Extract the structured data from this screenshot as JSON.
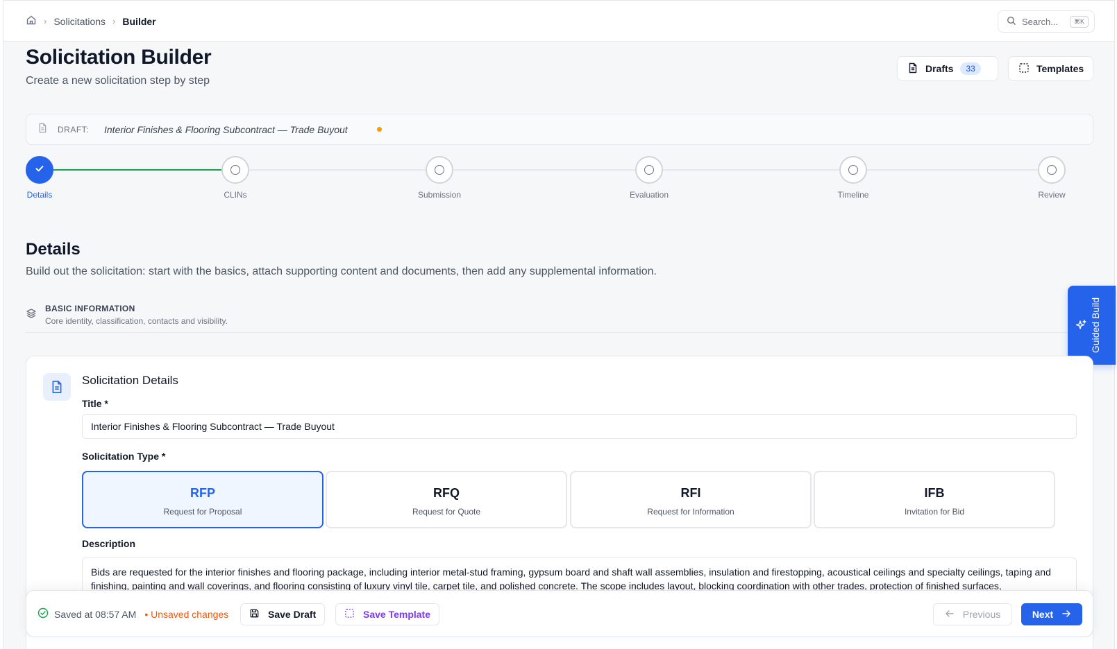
{
  "breadcrumb": {
    "home_icon": "home-icon",
    "items": [
      "Solicitations",
      "Builder"
    ]
  },
  "search": {
    "placeholder": "Search...",
    "shortcut": "⌘K"
  },
  "header": {
    "title": "Solicitation Builder",
    "subtitle": "Create a new solicitation step by step",
    "drafts_label": "Drafts",
    "drafts_count": "33",
    "templates_label": "Templates"
  },
  "draft": {
    "label": "DRAFT:",
    "title": "Interior Finishes & Flooring Subcontract — Trade Buyout",
    "unsaved_dot_color": "#f59e0b"
  },
  "steps": [
    {
      "label": "Details",
      "state": "complete"
    },
    {
      "label": "CLINs",
      "state": "pending"
    },
    {
      "label": "Submission",
      "state": "pending"
    },
    {
      "label": "Evaluation",
      "state": "pending"
    },
    {
      "label": "Timeline",
      "state": "pending"
    },
    {
      "label": "Review",
      "state": "pending"
    }
  ],
  "section": {
    "title": "Details",
    "description": "Build out the solicitation: start with the basics, attach supporting content and documents, then add any supplemental information."
  },
  "subsection": {
    "title": "BASIC INFORMATION",
    "description": "Core identity, classification, contacts and visibility."
  },
  "guided_build": {
    "label": "Guided Build",
    "icon": "sparkles-icon"
  },
  "card": {
    "title": "Solicitation Details",
    "title_label": "Title *",
    "title_value": "Interior Finishes & Flooring Subcontract — Trade Buyout",
    "type_label": "Solicitation Type *",
    "types": [
      {
        "code": "RFP",
        "name": "Request for Proposal",
        "selected": true
      },
      {
        "code": "RFQ",
        "name": "Request for Quote",
        "selected": false
      },
      {
        "code": "RFI",
        "name": "Request for Information",
        "selected": false
      },
      {
        "code": "IFB",
        "name": "Invitation for Bid",
        "selected": false
      }
    ],
    "description_label": "Description",
    "description_value": "Bids are requested for the interior finishes and flooring package, including interior metal-stud framing, gypsum board and shaft wall assemblies, insulation and firestopping, acoustical ceilings and specialty ceilings, taping and finishing, painting and wall coverings, and flooring consisting of luxury vinyl tile, carpet tile, and polished concrete. The scope includes layout, blocking coordination with other trades, protection of finished surfaces,"
  },
  "footer": {
    "saved_text": "Saved at 08:57 AM",
    "unsaved_text": "• Unsaved changes",
    "save_draft": "Save Draft",
    "save_template": "Save Template",
    "previous": "Previous",
    "next": "Next"
  },
  "colors": {
    "primary": "#2563eb",
    "success": "#16a34a",
    "warning": "#ea580c",
    "template": "#7c3aed"
  }
}
